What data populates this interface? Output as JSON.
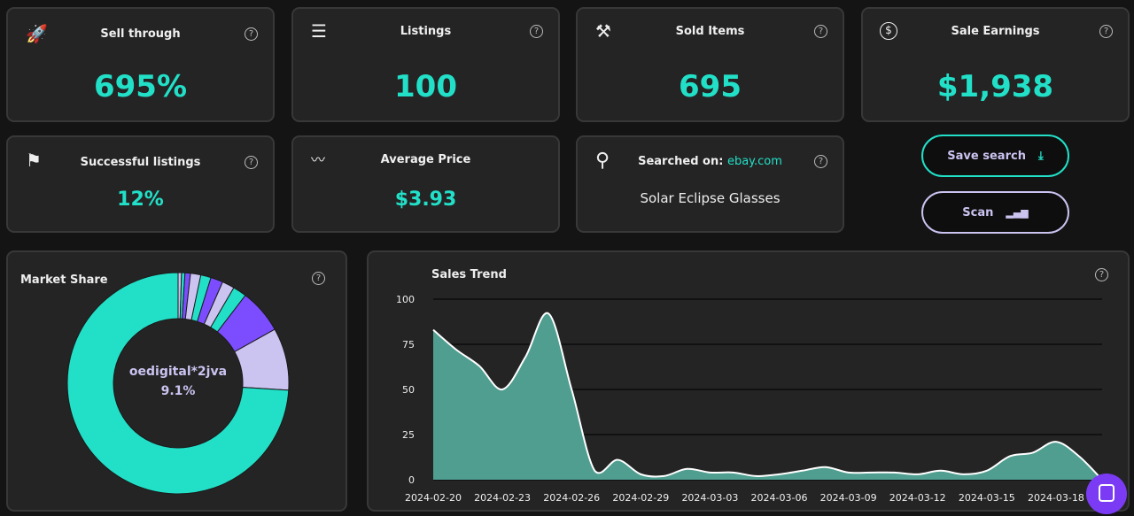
{
  "colors": {
    "accent": "#22e0c8",
    "purple": "#7b4dff",
    "lavender": "#cbc3f0",
    "card": "#242424"
  },
  "stats": [
    {
      "title": "Sell through",
      "value": "695%",
      "icon": "rocket-icon"
    },
    {
      "title": "Listings",
      "value": "100",
      "icon": "list-icon"
    },
    {
      "title": "Sold Items",
      "value": "695",
      "icon": "gavel-icon"
    },
    {
      "title": "Sale Earnings",
      "value": "$1,938",
      "icon": "dollar-icon"
    },
    {
      "title": "Successful listings",
      "value": "12%",
      "icon": "flag-icon"
    },
    {
      "title": "Average Price",
      "value": "$3.93",
      "icon": "trend-icon"
    }
  ],
  "search": {
    "label": "Searched on:",
    "site": "ebay.com",
    "query": "Solar Eclipse Glasses"
  },
  "buttons": {
    "save": "Save search",
    "scan": "Scan"
  },
  "help": "?",
  "chart_data": [
    {
      "type": "pie",
      "title": "Market Share",
      "donut": true,
      "center_label": "oedigital*2jva",
      "center_value": "9.1%",
      "slices": [
        {
          "value": 0.5,
          "color": "#cbc3f0"
        },
        {
          "value": 0.5,
          "color": "#22e0c8"
        },
        {
          "value": 0.8,
          "color": "#7b4dff"
        },
        {
          "value": 1.5,
          "color": "#cbc3f0"
        },
        {
          "value": 1.5,
          "color": "#22e0c8"
        },
        {
          "value": 1.8,
          "color": "#7b4dff"
        },
        {
          "value": 1.8,
          "color": "#cbc3f0"
        },
        {
          "value": 2.0,
          "color": "#22e0c8"
        },
        {
          "value": 6.5,
          "color": "#7b4dff"
        },
        {
          "value": 9.1,
          "color": "#cbc3f0"
        },
        {
          "value": 74.0,
          "color": "#22e0c8"
        }
      ]
    },
    {
      "type": "area",
      "title": "Sales Trend",
      "ylim": [
        0,
        100
      ],
      "yticks": [
        "100",
        "75",
        "50",
        "25",
        "0"
      ],
      "grid": true,
      "x": [
        "2024-02-20",
        "2024-02-21",
        "2024-02-22",
        "2024-02-23",
        "2024-02-24",
        "2024-02-25",
        "2024-02-26",
        "2024-02-27",
        "2024-02-28",
        "2024-02-29",
        "2024-03-01",
        "2024-03-02",
        "2024-03-03",
        "2024-03-04",
        "2024-03-05",
        "2024-03-06",
        "2024-03-07",
        "2024-03-08",
        "2024-03-09",
        "2024-03-10",
        "2024-03-11",
        "2024-03-12",
        "2024-03-13",
        "2024-03-14",
        "2024-03-15",
        "2024-03-16",
        "2024-03-17",
        "2024-03-18",
        "2024-03-19",
        "2024-03-20"
      ],
      "y": [
        83,
        72,
        63,
        50,
        68,
        92,
        50,
        5,
        11,
        3,
        2,
        6,
        4,
        4,
        2,
        3,
        5,
        7,
        4,
        4,
        4,
        3,
        5,
        3,
        5,
        13,
        15,
        21,
        13,
        0
      ],
      "xticks": [
        "2024-02-20",
        "2024-02-23",
        "2024-02-26",
        "2024-02-29",
        "2024-03-03",
        "2024-03-06",
        "2024-03-09",
        "2024-03-12",
        "2024-03-15",
        "2024-03-18"
      ]
    }
  ]
}
